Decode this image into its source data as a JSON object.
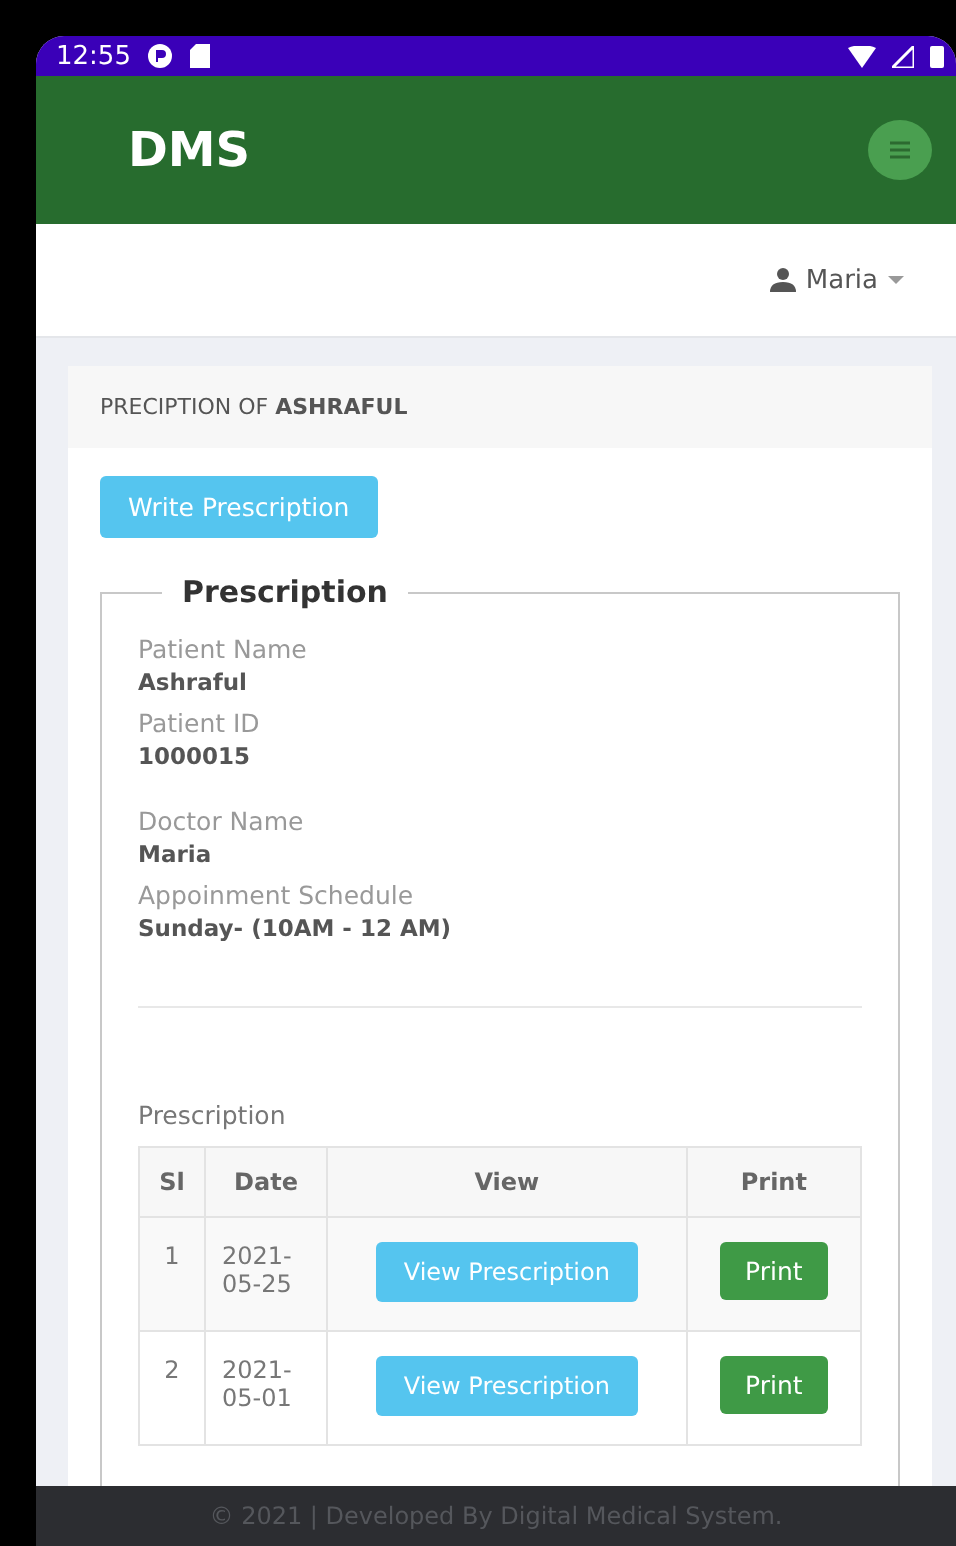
{
  "status_bar": {
    "time": "12:55"
  },
  "header": {
    "brand": "DMS"
  },
  "user_menu": {
    "name": "Maria"
  },
  "card": {
    "title": "PRECIPTION OF **ASHRAFUL**",
    "write_button": "Write Prescription",
    "fieldset": {
      "legend": "Prescription",
      "groups": [
        [
          {
            "label": "Patient Name",
            "value": "Ashraful"
          },
          {
            "label": "Patient ID",
            "value": "1000015"
          }
        ],
        [
          {
            "label": "Doctor Name",
            "value": "Maria"
          },
          {
            "label": "Appoinment Schedule",
            "value": "Sunday- (10AM - 12 AM)"
          }
        ]
      ],
      "table_title": "Prescription",
      "table": {
        "columns": [
          "Sl",
          "Date",
          "View",
          "Print"
        ],
        "rows": [
          {
            "sl": "1",
            "date": "2021-05-25",
            "view": "View Prescription",
            "print": "Print"
          },
          {
            "sl": "2",
            "date": "2021-05-01",
            "view": "View Prescription",
            "print": "Print"
          }
        ]
      }
    }
  },
  "footer": {
    "text": "© 2021 | Developed By Digital Medical System."
  }
}
